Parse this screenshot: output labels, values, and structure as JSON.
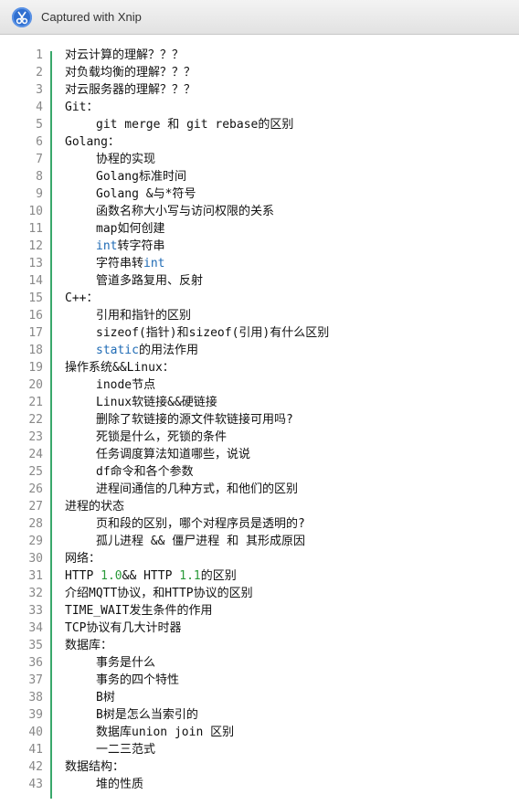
{
  "window": {
    "title": "Captured with Xnip",
    "icon": "scissors-icon",
    "accent": "#2f6fd0"
  },
  "colors": {
    "keyword": "#1f6bb5",
    "number": "#2a9a3a",
    "gutter_bar": "#39a86b"
  },
  "lines": [
    {
      "n": "1",
      "indent": false,
      "segs": [
        {
          "t": "对云计算的理解？？？",
          "c": ""
        }
      ]
    },
    {
      "n": "2",
      "indent": false,
      "segs": [
        {
          "t": "对负载均衡的理解？？？",
          "c": ""
        }
      ]
    },
    {
      "n": "3",
      "indent": false,
      "segs": [
        {
          "t": "对云服务器的理解？？？",
          "c": ""
        }
      ]
    },
    {
      "n": "4",
      "indent": false,
      "segs": [
        {
          "t": "Git：",
          "c": ""
        }
      ]
    },
    {
      "n": "5",
      "indent": true,
      "segs": [
        {
          "t": "git merge 和 git rebase的区别",
          "c": ""
        }
      ]
    },
    {
      "n": "6",
      "indent": false,
      "segs": [
        {
          "t": "Golang：",
          "c": ""
        }
      ]
    },
    {
      "n": "7",
      "indent": true,
      "segs": [
        {
          "t": "协程的实现",
          "c": ""
        }
      ]
    },
    {
      "n": "8",
      "indent": true,
      "segs": [
        {
          "t": "Golang标准时间",
          "c": ""
        }
      ]
    },
    {
      "n": "9",
      "indent": true,
      "segs": [
        {
          "t": "Golang &与*符号",
          "c": ""
        }
      ]
    },
    {
      "n": "10",
      "indent": true,
      "segs": [
        {
          "t": "函数名称大小写与访问权限的关系",
          "c": ""
        }
      ]
    },
    {
      "n": "11",
      "indent": true,
      "segs": [
        {
          "t": "map如何创建",
          "c": ""
        }
      ]
    },
    {
      "n": "12",
      "indent": true,
      "segs": [
        {
          "t": "int",
          "c": "kw"
        },
        {
          "t": "转字符串",
          "c": ""
        }
      ]
    },
    {
      "n": "13",
      "indent": true,
      "segs": [
        {
          "t": "字符串转",
          "c": ""
        },
        {
          "t": "int",
          "c": "kw"
        }
      ]
    },
    {
      "n": "14",
      "indent": true,
      "segs": [
        {
          "t": "管道多路复用、反射",
          "c": ""
        }
      ]
    },
    {
      "n": "15",
      "indent": false,
      "segs": [
        {
          "t": "C++：",
          "c": ""
        }
      ]
    },
    {
      "n": "16",
      "indent": true,
      "segs": [
        {
          "t": "引用和指针的区别",
          "c": ""
        }
      ]
    },
    {
      "n": "17",
      "indent": true,
      "segs": [
        {
          "t": "sizeof(指针)和sizeof(引用)有什么区别",
          "c": ""
        }
      ]
    },
    {
      "n": "18",
      "indent": true,
      "segs": [
        {
          "t": "static",
          "c": "kw"
        },
        {
          "t": "的用法作用",
          "c": ""
        }
      ]
    },
    {
      "n": "19",
      "indent": false,
      "segs": [
        {
          "t": "操作系统&&Linux：",
          "c": ""
        }
      ]
    },
    {
      "n": "20",
      "indent": true,
      "segs": [
        {
          "t": "inode节点",
          "c": ""
        }
      ]
    },
    {
      "n": "21",
      "indent": true,
      "segs": [
        {
          "t": "Linux软链接&&硬链接",
          "c": ""
        }
      ]
    },
    {
      "n": "22",
      "indent": true,
      "segs": [
        {
          "t": "删除了软链接的源文件软链接可用吗?",
          "c": ""
        }
      ]
    },
    {
      "n": "23",
      "indent": true,
      "segs": [
        {
          "t": "死锁是什么，死锁的条件",
          "c": ""
        }
      ]
    },
    {
      "n": "24",
      "indent": true,
      "segs": [
        {
          "t": "任务调度算法知道哪些，说说",
          "c": ""
        }
      ]
    },
    {
      "n": "25",
      "indent": true,
      "segs": [
        {
          "t": "df命令和各个参数",
          "c": ""
        }
      ]
    },
    {
      "n": "26",
      "indent": true,
      "segs": [
        {
          "t": "进程间通信的几种方式，和他们的区别",
          "c": ""
        }
      ]
    },
    {
      "n": "27",
      "indent": false,
      "segs": [
        {
          "t": "进程的状态",
          "c": ""
        }
      ]
    },
    {
      "n": "28",
      "indent": true,
      "segs": [
        {
          "t": "页和段的区别，哪个对程序员是透明的?",
          "c": ""
        }
      ]
    },
    {
      "n": "29",
      "indent": true,
      "segs": [
        {
          "t": "孤儿进程 && 僵尸进程 和 其形成原因",
          "c": ""
        }
      ]
    },
    {
      "n": "30",
      "indent": false,
      "segs": [
        {
          "t": "网络：",
          "c": ""
        }
      ]
    },
    {
      "n": "31",
      "indent": false,
      "segs": [
        {
          "t": "HTTP ",
          "c": ""
        },
        {
          "t": "1.0",
          "c": "num"
        },
        {
          "t": "&& HTTP ",
          "c": ""
        },
        {
          "t": "1.1",
          "c": "num"
        },
        {
          "t": "的区别",
          "c": ""
        }
      ]
    },
    {
      "n": "32",
      "indent": false,
      "segs": [
        {
          "t": "介绍MQTT协议，和HTTP协议的区别",
          "c": ""
        }
      ]
    },
    {
      "n": "33",
      "indent": false,
      "segs": [
        {
          "t": "TIME_WAIT发生条件的作用",
          "c": ""
        }
      ]
    },
    {
      "n": "34",
      "indent": false,
      "segs": [
        {
          "t": "TCP协议有几大计时器",
          "c": ""
        }
      ]
    },
    {
      "n": "35",
      "indent": false,
      "segs": [
        {
          "t": "数据库：",
          "c": ""
        }
      ]
    },
    {
      "n": "36",
      "indent": true,
      "segs": [
        {
          "t": "事务是什么",
          "c": ""
        }
      ]
    },
    {
      "n": "37",
      "indent": true,
      "segs": [
        {
          "t": "事务的四个特性",
          "c": ""
        }
      ]
    },
    {
      "n": "38",
      "indent": true,
      "segs": [
        {
          "t": "B树",
          "c": ""
        }
      ]
    },
    {
      "n": "39",
      "indent": true,
      "segs": [
        {
          "t": "B树是怎么当索引的",
          "c": ""
        }
      ]
    },
    {
      "n": "40",
      "indent": true,
      "segs": [
        {
          "t": "数据库union join 区别",
          "c": ""
        }
      ]
    },
    {
      "n": "41",
      "indent": true,
      "segs": [
        {
          "t": "一二三范式",
          "c": ""
        }
      ]
    },
    {
      "n": "42",
      "indent": false,
      "segs": [
        {
          "t": "数据结构：",
          "c": ""
        }
      ]
    },
    {
      "n": "43",
      "indent": true,
      "segs": [
        {
          "t": "堆的性质",
          "c": ""
        }
      ]
    }
  ]
}
